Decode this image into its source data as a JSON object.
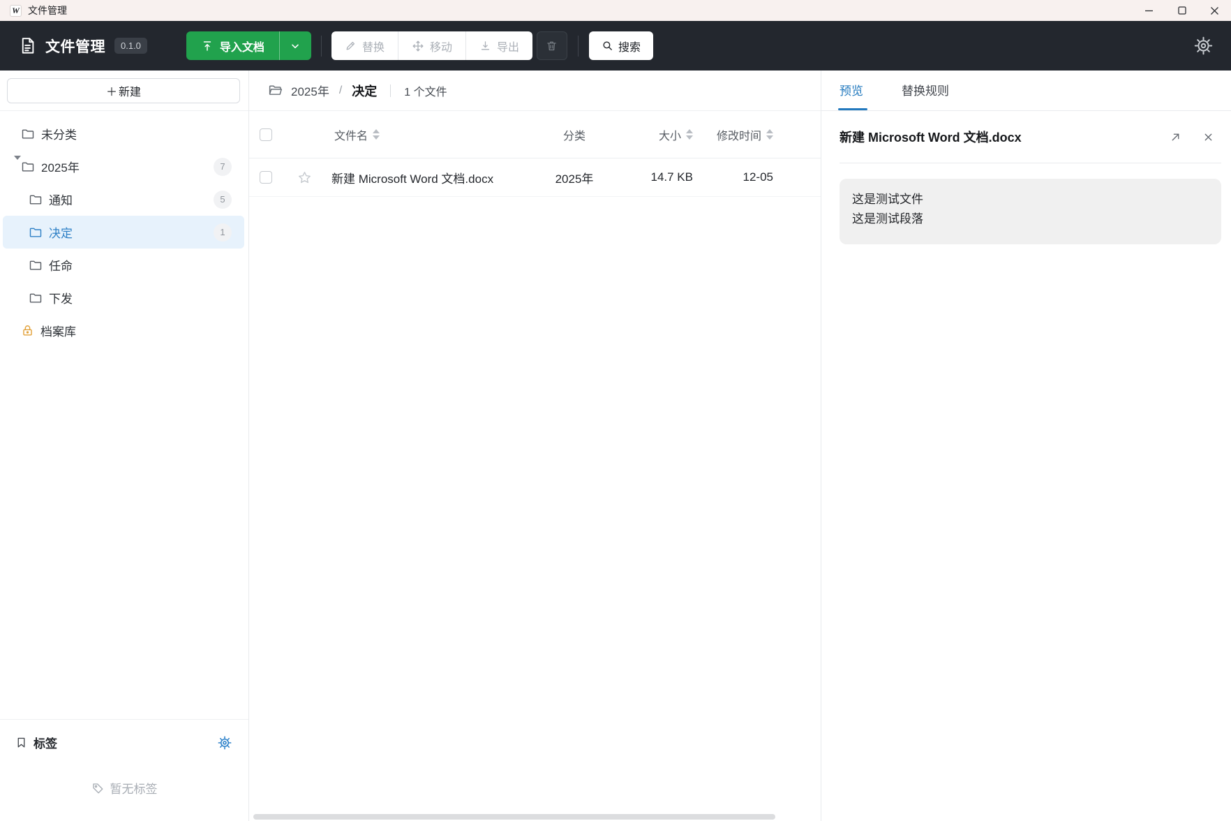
{
  "window": {
    "title": "文件管理",
    "icon_letter": "W"
  },
  "toolbar": {
    "app_name": "文件管理",
    "version": "0.1.0",
    "import_label": "导入文档",
    "replace_label": "替换",
    "move_label": "移动",
    "export_label": "导出",
    "search_label": "搜索"
  },
  "sidebar": {
    "plus_icon": "＋",
    "new_label": "新建",
    "tree": [
      {
        "label": "未分类"
      },
      {
        "label": "2025年",
        "count": "7"
      },
      {
        "label": "通知",
        "count": "5"
      },
      {
        "label": "决定",
        "count": "1"
      },
      {
        "label": "任命"
      },
      {
        "label": "下发"
      },
      {
        "label": "档案库"
      }
    ],
    "tags_title": "标签",
    "empty_tags": "暂无标签"
  },
  "breadcrumb": {
    "parent": "2025年",
    "separator": "/",
    "current": "决定",
    "file_count": "1 个文件"
  },
  "table": {
    "headers": {
      "name": "文件名",
      "category": "分类",
      "size": "大小",
      "modified": "修改时间"
    },
    "rows": [
      {
        "name": "新建 Microsoft Word 文档.docx",
        "category": "2025年",
        "size": "14.7 KB",
        "modified": "12-05"
      }
    ]
  },
  "panel": {
    "tabs": {
      "preview": "预览",
      "rules": "替换规则"
    },
    "file_title": "新建 Microsoft Word 文档.docx",
    "lines": [
      "这是测试文件",
      "这是测试段落"
    ]
  },
  "colors": {
    "accent_green": "#21a24d",
    "accent_blue": "#2279be",
    "selection_bg": "#e7f2fc",
    "toolbar_bg": "#23272e",
    "titlebar_bg": "#f8f1ef",
    "lock_orange": "#e2a23b"
  }
}
